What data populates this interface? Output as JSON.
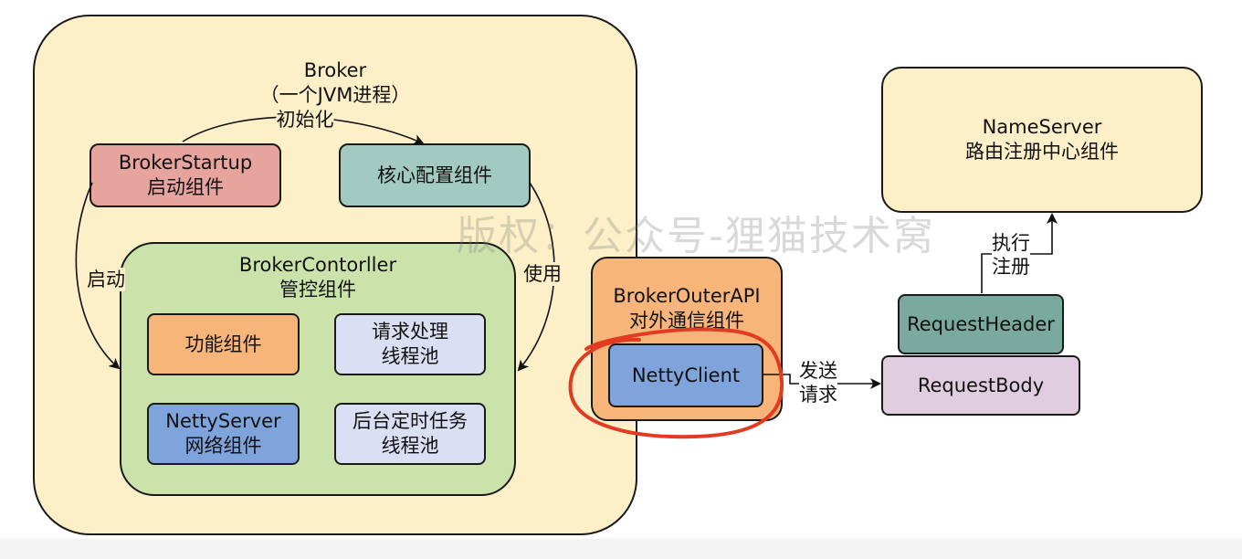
{
  "broker": {
    "title": "Broker",
    "subtitle": "（一个JVM进程）"
  },
  "nameserver": {
    "title": "NameServer",
    "subtitle": "路由注册中心组件"
  },
  "broker_startup": {
    "title": "BrokerStartup",
    "subtitle": "启动组件"
  },
  "core_config": {
    "title": "核心配置组件"
  },
  "controller": {
    "title": "BrokerContorller",
    "subtitle": "管控组件"
  },
  "function_component": {
    "title": "功能组件"
  },
  "request_pool": {
    "line1": "请求处理",
    "line2": "线程池"
  },
  "netty_server": {
    "title": "NettyServer",
    "subtitle": "网络组件"
  },
  "background_pool": {
    "line1": "后台定时任务",
    "line2": "线程池"
  },
  "outer_api": {
    "title": "BrokerOuterAPI",
    "subtitle": "对外通信组件"
  },
  "netty_client": {
    "title": "NettyClient"
  },
  "request_header": {
    "title": "RequestHeader"
  },
  "request_body": {
    "title": "RequestBody"
  },
  "edges": {
    "init": "初始化",
    "start": "启动",
    "use": "使用",
    "send_line1": "发送",
    "send_line2": "请求",
    "exec_line1": "执行",
    "exec_line2": "注册"
  },
  "watermark": "版权：公众号-狸猫技术窝",
  "colors": {
    "container_fill": "#fdf0c8",
    "startup_fill": "#e7a39d",
    "config_fill": "#a3cac0",
    "controller_fill": "#cbe3ab",
    "function_fill": "#f7b57a",
    "pool_fill": "#dadff3",
    "netty_fill": "#7fa3db",
    "header_fill": "#7aa99d",
    "body_fill": "#e0cde0",
    "highlight_circle": "#e23b22"
  }
}
